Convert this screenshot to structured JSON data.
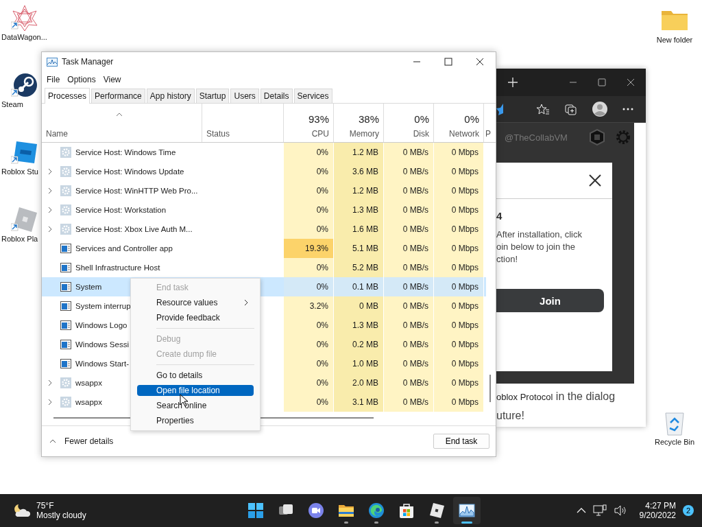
{
  "desktop_icons": [
    {
      "label": "DataWagon...",
      "kind": "mandala"
    },
    {
      "label": "Steam",
      "kind": "steam"
    },
    {
      "label": "Roblox Stu",
      "kind": "studio"
    },
    {
      "label": "Roblox Pla",
      "kind": "player"
    },
    {
      "label": "New folder",
      "kind": "folder"
    },
    {
      "label": "Recycle Bin",
      "kind": "bin"
    }
  ],
  "browser": {
    "page_header": "@TheCollabVM",
    "dialog": {
      "heading": "4",
      "text": "After installation, click\noin below to join the\nction!",
      "button": "Join"
    },
    "page_lines": [
      "**oblox Protocol** in the dialog",
      "uture!"
    ]
  },
  "task_manager": {
    "title": "Task Manager",
    "menu": [
      "File",
      "Options",
      "View"
    ],
    "tabs": [
      {
        "label": "Processes",
        "selected": true
      },
      {
        "label": "Performance",
        "selected": false
      },
      {
        "label": "App history",
        "selected": false
      },
      {
        "label": "Startup",
        "selected": false
      },
      {
        "label": "Users",
        "selected": false
      },
      {
        "label": "Details",
        "selected": false
      },
      {
        "label": "Services",
        "selected": false
      }
    ],
    "columns": [
      {
        "kind": "name",
        "label": "Name"
      },
      {
        "kind": "status",
        "label": "Status"
      },
      {
        "kind": "metric",
        "usage": "93%",
        "label": "CPU"
      },
      {
        "kind": "metric",
        "usage": "38%",
        "label": "Memory"
      },
      {
        "kind": "metric",
        "usage": "0%",
        "label": "Disk"
      },
      {
        "kind": "metric",
        "usage": "0%",
        "label": "Network"
      },
      {
        "kind": "cut",
        "label": "P"
      }
    ],
    "rows": [
      {
        "name": "Service Host: Windows Time",
        "kind": "gear",
        "expandable": false,
        "selected": false,
        "cpu": "0%",
        "cpu_hot": false,
        "memory": "1.2 MB",
        "disk": "0 MB/s",
        "network": "0 Mbps"
      },
      {
        "name": "Service Host: Windows Update",
        "kind": "gear",
        "expandable": true,
        "selected": false,
        "cpu": "0%",
        "cpu_hot": false,
        "memory": "3.6 MB",
        "disk": "0 MB/s",
        "network": "0 Mbps"
      },
      {
        "name": "Service Host: WinHTTP Web Pro...",
        "kind": "gear",
        "expandable": true,
        "selected": false,
        "cpu": "0%",
        "cpu_hot": false,
        "memory": "1.2 MB",
        "disk": "0 MB/s",
        "network": "0 Mbps"
      },
      {
        "name": "Service Host: Workstation",
        "kind": "gear",
        "expandable": true,
        "selected": false,
        "cpu": "0%",
        "cpu_hot": false,
        "memory": "1.3 MB",
        "disk": "0 MB/s",
        "network": "0 Mbps"
      },
      {
        "name": "Service Host: Xbox Live Auth M...",
        "kind": "gear",
        "expandable": true,
        "selected": false,
        "cpu": "0%",
        "cpu_hot": false,
        "memory": "1.6 MB",
        "disk": "0 MB/s",
        "network": "0 Mbps"
      },
      {
        "name": "Services and Controller app",
        "kind": "app",
        "expandable": false,
        "selected": false,
        "cpu": "19.3%",
        "cpu_hot": true,
        "memory": "5.1 MB",
        "disk": "0 MB/s",
        "network": "0 Mbps"
      },
      {
        "name": "Shell Infrastructure Host",
        "kind": "app",
        "expandable": false,
        "selected": false,
        "cpu": "0%",
        "cpu_hot": false,
        "memory": "5.2 MB",
        "disk": "0 MB/s",
        "network": "0 Mbps"
      },
      {
        "name": "System",
        "kind": "app",
        "expandable": false,
        "selected": true,
        "cpu": "0%",
        "cpu_hot": false,
        "memory": "0.1 MB",
        "disk": "0 MB/s",
        "network": "0 Mbps"
      },
      {
        "name": "System interrup",
        "kind": "app",
        "expandable": false,
        "selected": false,
        "cpu": "3.2%",
        "cpu_hot": false,
        "memory": "0 MB",
        "disk": "0 MB/s",
        "network": "0 Mbps"
      },
      {
        "name": "Windows Logo",
        "kind": "app",
        "expandable": false,
        "selected": false,
        "cpu": "0%",
        "cpu_hot": false,
        "memory": "1.3 MB",
        "disk": "0 MB/s",
        "network": "0 Mbps"
      },
      {
        "name": "Windows Sessi",
        "kind": "app",
        "expandable": false,
        "selected": false,
        "cpu": "0%",
        "cpu_hot": false,
        "memory": "0.2 MB",
        "disk": "0 MB/s",
        "network": "0 Mbps"
      },
      {
        "name": "Windows Start-",
        "kind": "app",
        "expandable": false,
        "selected": false,
        "cpu": "0%",
        "cpu_hot": false,
        "memory": "1.0 MB",
        "disk": "0 MB/s",
        "network": "0 Mbps"
      },
      {
        "name": "wsappx",
        "kind": "gear",
        "expandable": true,
        "selected": false,
        "cpu": "0%",
        "cpu_hot": false,
        "memory": "2.0 MB",
        "disk": "0 MB/s",
        "network": "0 Mbps"
      },
      {
        "name": "wsappx",
        "kind": "gear",
        "expandable": true,
        "selected": false,
        "cpu": "0%",
        "cpu_hot": false,
        "memory": "3.1 MB",
        "disk": "0 MB/s",
        "network": "0 Mbps"
      }
    ],
    "context_menu": [
      {
        "kind": "item",
        "label": "End task",
        "disabled": true,
        "selected": false,
        "submenu": false
      },
      {
        "kind": "item",
        "label": "Resource values",
        "disabled": false,
        "selected": false,
        "submenu": true
      },
      {
        "kind": "item",
        "label": "Provide feedback",
        "disabled": false,
        "selected": false,
        "submenu": false
      },
      {
        "kind": "separator"
      },
      {
        "kind": "item",
        "label": "Debug",
        "disabled": true,
        "selected": false,
        "submenu": false
      },
      {
        "kind": "item",
        "label": "Create dump file",
        "disabled": true,
        "selected": false,
        "submenu": false
      },
      {
        "kind": "separator"
      },
      {
        "kind": "item",
        "label": "Go to details",
        "disabled": false,
        "selected": false,
        "submenu": false
      },
      {
        "kind": "item",
        "label": "Open file location",
        "disabled": false,
        "selected": true,
        "submenu": false
      },
      {
        "kind": "item",
        "label": "Search online",
        "disabled": false,
        "selected": false,
        "submenu": false
      },
      {
        "kind": "item",
        "label": "Properties",
        "disabled": false,
        "selected": false,
        "submenu": false
      }
    ],
    "footer": {
      "toggle": "Fewer details",
      "button": "End task"
    }
  },
  "taskbar": {
    "weather": {
      "temperature": "75°F",
      "condition": "Mostly cloudy"
    },
    "apps": [
      {
        "kind": "start",
        "running": false,
        "active": false
      },
      {
        "kind": "taskview",
        "running": false,
        "active": false
      },
      {
        "kind": "chat",
        "running": false,
        "active": false
      },
      {
        "kind": "explorer",
        "running": true,
        "active": false
      },
      {
        "kind": "edge",
        "running": true,
        "active": false
      },
      {
        "kind": "store",
        "running": false,
        "active": false
      },
      {
        "kind": "roblox",
        "running": true,
        "active": false
      },
      {
        "kind": "taskmanager",
        "running": true,
        "active": true
      }
    ],
    "time": "4:27 PM",
    "date": "9/20/2022",
    "notifications": "2"
  }
}
